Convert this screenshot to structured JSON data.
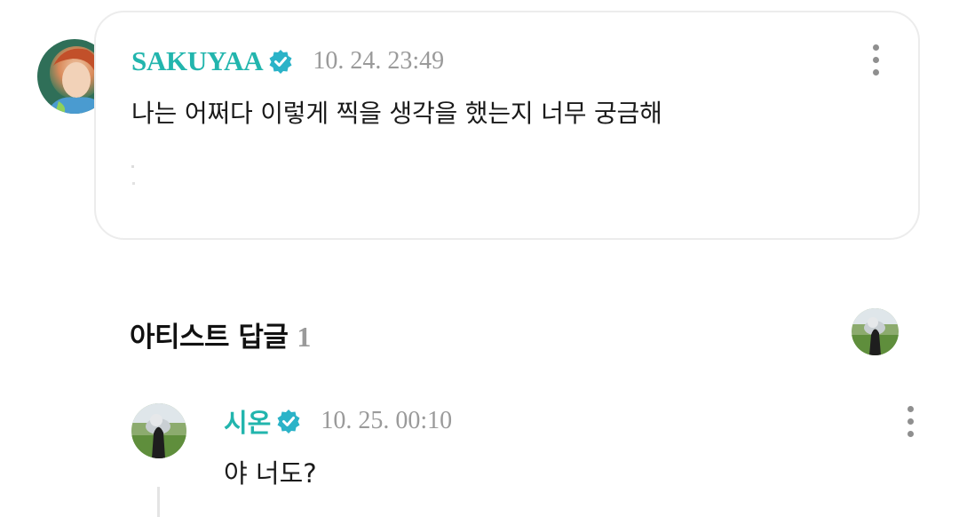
{
  "post": {
    "username": "SAKUYAA",
    "timestamp": "10. 24. 23:49",
    "text": "나는 어쩌다 이렇게 찍을 생각을 했는지 너무 궁금해"
  },
  "artist_replies": {
    "title": "아티스트 답글",
    "count": "1"
  },
  "reply": {
    "username": "시온",
    "timestamp": "10. 25. 00:10",
    "text": "야 너도?"
  },
  "colors": {
    "accent": "#22b5ad",
    "verified_badge": "#2bb3c8",
    "timestamp": "#9a9a9a",
    "card_border": "#ececec"
  },
  "icons": {
    "verified": "verified-badge-icon",
    "more": "more-vertical-icon"
  }
}
